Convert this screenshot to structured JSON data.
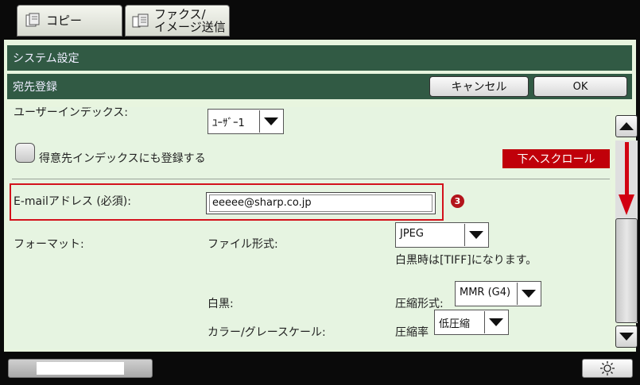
{
  "tabs": [
    {
      "label": "コピー"
    },
    {
      "label_line1": "ファクス/",
      "label_line2": "イメージ送信"
    }
  ],
  "header": {
    "system_settings": "システム設定",
    "address_registration": "宛先登録",
    "cancel_label": "キャンセル",
    "ok_label": "OK"
  },
  "form": {
    "user_index_label": "ユーザーインデックス:",
    "user_index_value": "ﾕｰｻﾞｰ1",
    "favorites_label": "得意先インデックスにも登録する",
    "scroll_down_label": "下へスクロール",
    "email_label": "E-mailアドレス (必須):",
    "email_value": "eeeee@sharp.co.jp",
    "callout_number": "3",
    "format_label": "フォーマット:",
    "file_format_label": "ファイル形式:",
    "file_format_value": "JPEG",
    "bw_note": "白黒時は[TIFF]になります。",
    "bw_label": "白黒:",
    "compression_format_label": "圧縮形式:",
    "compression_format_value": "MMR (G4)",
    "color_label": "カラー/グレースケール:",
    "compression_ratio_label": "圧縮率",
    "compression_ratio_value": "低圧縮"
  },
  "colors": {
    "header_bar": "#315a44",
    "panel_bg": "#e8f5df",
    "accent_red": "#c0000a",
    "scroll_arrow": "#d10012"
  },
  "icons": {
    "copy_tab": "copy-icon",
    "fax_tab": "fax-scan-icon",
    "brightness": "sun-icon"
  }
}
